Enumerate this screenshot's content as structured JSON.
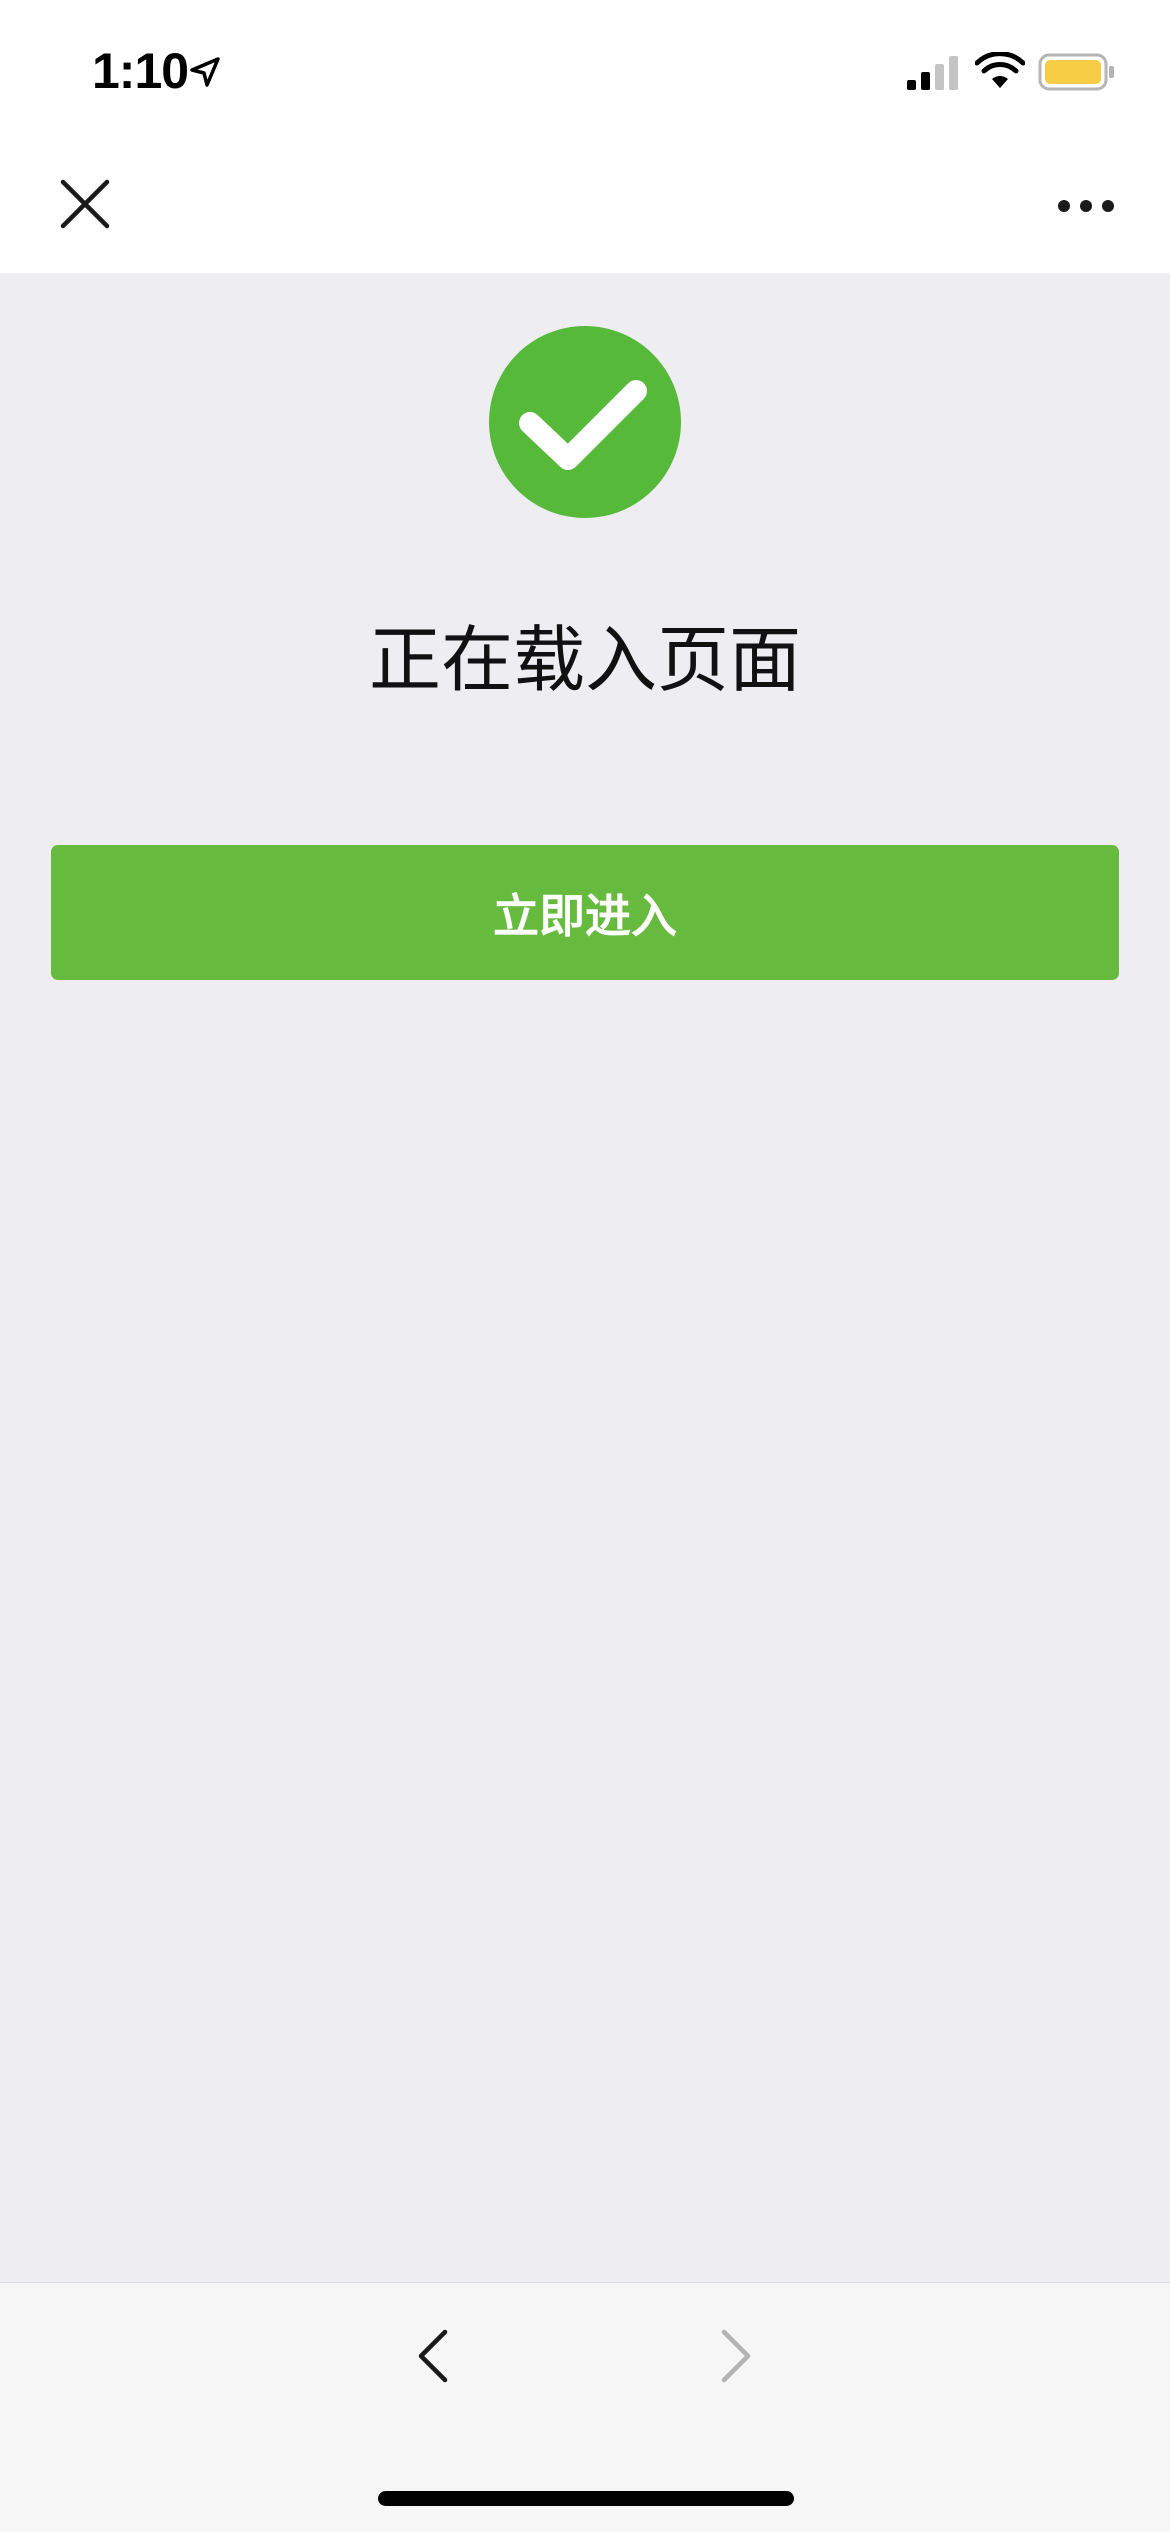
{
  "status_bar": {
    "time": "1:10",
    "icons": [
      "location-arrow-icon",
      "cellular-signal-icon",
      "wifi-icon",
      "battery-icon"
    ],
    "battery_color": "#f7cd46"
  },
  "nav_bar": {
    "close_icon": "close-icon",
    "more_icon": "more-icon"
  },
  "content": {
    "status_icon": "check-circle-icon",
    "status_color": "#57b93a",
    "title": "正在载入页面",
    "enter_button_label": "立即进入",
    "button_color": "#66bb3f"
  },
  "bottom_bar": {
    "back_icon": "chevron-left-icon",
    "forward_icon": "chevron-right-icon",
    "forward_enabled": false
  }
}
